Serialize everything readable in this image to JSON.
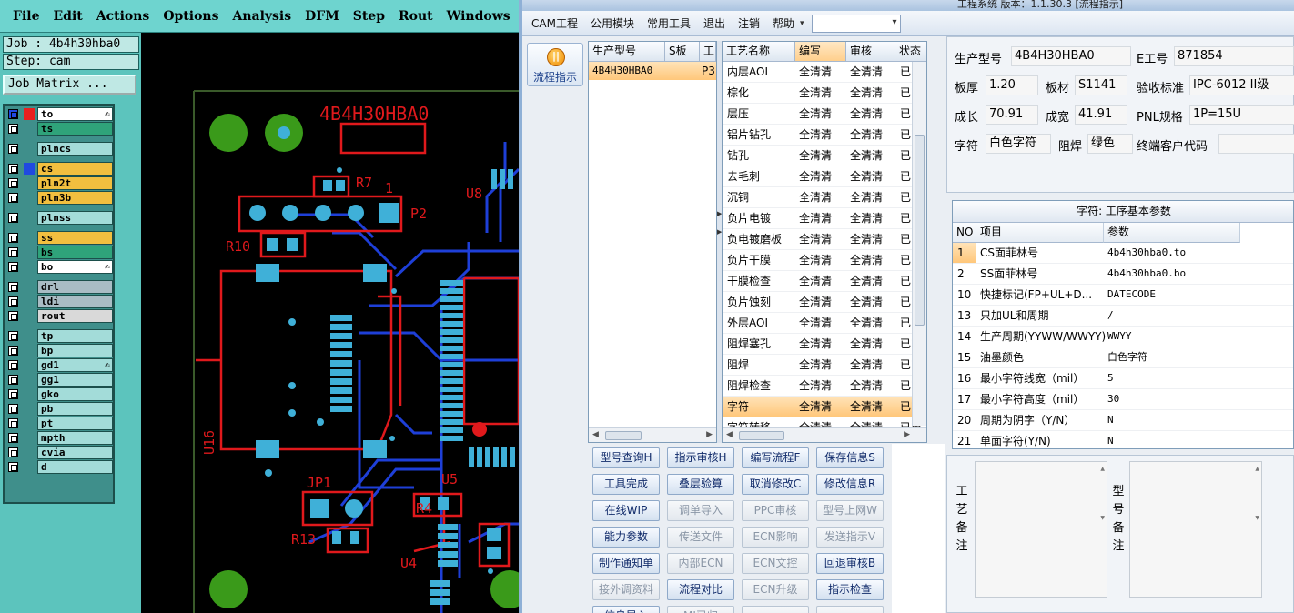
{
  "genesis": {
    "menu": [
      "File",
      "Edit",
      "Actions",
      "Options",
      "Analysis",
      "DFM",
      "Step",
      "Rout",
      "Windows"
    ],
    "job_line": "Job : 4b4h30hba0",
    "step_line": "Step: cam",
    "job_matrix": "Job Matrix ...",
    "layers": [
      {
        "name": "to",
        "color": "#ffffff",
        "swatch": "#e8201f",
        "active": true,
        "edit": true
      },
      {
        "name": "ts",
        "color": "#2fa37a",
        "swatch": "",
        "edit": false
      },
      {
        "name": "plncs",
        "color": "#a3dcd9",
        "swatch": "",
        "edit": false
      },
      {
        "name": "cs",
        "color": "#f2bf3f",
        "swatch": "#2049e0",
        "edit": false
      },
      {
        "name": "pln2t",
        "color": "#f2bf3f",
        "swatch": "",
        "edit": false
      },
      {
        "name": "pln3b",
        "color": "#f2bf3f",
        "swatch": "",
        "edit": false
      },
      {
        "name": "plnss",
        "color": "#a3dcd9",
        "swatch": "",
        "edit": false
      },
      {
        "name": "ss",
        "color": "#f2bf3f",
        "swatch": "",
        "edit": false
      },
      {
        "name": "bs",
        "color": "#2fa37a",
        "swatch": "",
        "edit": false
      },
      {
        "name": "bo",
        "color": "#ffffff",
        "swatch": "",
        "edit": true
      },
      {
        "name": "drl",
        "color": "#a9bcc4",
        "swatch": "",
        "edit": false
      },
      {
        "name": "ldi",
        "color": "#a9bcc4",
        "swatch": "",
        "edit": false
      },
      {
        "name": "rout",
        "color": "#d9d9d9",
        "swatch": "",
        "edit": false
      },
      {
        "name": "tp",
        "color": "#a3dcd9",
        "swatch": "",
        "edit": false
      },
      {
        "name": "bp",
        "color": "#a3dcd9",
        "swatch": "",
        "edit": false
      },
      {
        "name": "gd1",
        "color": "#a3dcd9",
        "swatch": "",
        "edit": true
      },
      {
        "name": "gg1",
        "color": "#a3dcd9",
        "swatch": "",
        "edit": false
      },
      {
        "name": "gko",
        "color": "#a3dcd9",
        "swatch": "",
        "edit": false
      },
      {
        "name": "pb",
        "color": "#a3dcd9",
        "swatch": "",
        "edit": false
      },
      {
        "name": "pt",
        "color": "#a3dcd9",
        "swatch": "",
        "edit": false
      },
      {
        "name": "mpth",
        "color": "#a3dcd9",
        "swatch": "",
        "edit": false
      },
      {
        "name": "cvia",
        "color": "#a3dcd9",
        "swatch": "",
        "edit": false
      },
      {
        "name": "d",
        "color": "#a3dcd9",
        "swatch": "",
        "edit": false
      }
    ],
    "board": {
      "title_text": "4B4H30HBA0",
      "refdes": [
        "R7",
        "1",
        "P2",
        "U8",
        "R10",
        "U16",
        "JP1",
        "U5",
        "R4",
        "R13",
        "U4"
      ]
    }
  },
  "cam": {
    "title_fragment": "工程系统  版本：1.1.30.3  [流程指示]",
    "menu": [
      "CAM工程",
      "公用模块",
      "常用工具",
      "退出",
      "注销",
      "帮助"
    ],
    "flow_button": "流程指示",
    "model_list": {
      "headers": [
        "生产型号",
        "S板",
        "工"
      ],
      "rows": [
        {
          "model": "4B4H30HBA0",
          "s": "P3"
        }
      ]
    },
    "process_list": {
      "headers": [
        "工艺名称",
        "编写",
        "审核",
        "状态"
      ],
      "rows": [
        [
          "内层AOI",
          "全清清",
          "全清清",
          "已审"
        ],
        [
          "棕化",
          "全清清",
          "全清清",
          "已审"
        ],
        [
          "层压",
          "全清清",
          "全清清",
          "已审"
        ],
        [
          "铝片钻孔",
          "全清清",
          "全清清",
          "已审"
        ],
        [
          "钻孔",
          "全清清",
          "全清清",
          "已审"
        ],
        [
          "去毛刺",
          "全清清",
          "全清清",
          "已审"
        ],
        [
          "沉铜",
          "全清清",
          "全清清",
          "已审"
        ],
        [
          "负片电镀",
          "全清清",
          "全清清",
          "已审"
        ],
        [
          "负电镀磨板",
          "全清清",
          "全清清",
          "已审"
        ],
        [
          "负片干膜",
          "全清清",
          "全清清",
          "已审"
        ],
        [
          "干膜检查",
          "全清清",
          "全清清",
          "已审"
        ],
        [
          "负片蚀刻",
          "全清清",
          "全清清",
          "已审"
        ],
        [
          "外层AOI",
          "全清清",
          "全清清",
          "已审"
        ],
        [
          "阻焊塞孔",
          "全清清",
          "全清清",
          "已审"
        ],
        [
          "阻焊",
          "全清清",
          "全清清",
          "已审"
        ],
        [
          "阻焊检查",
          "全清清",
          "全清清",
          "已审"
        ],
        [
          "字符",
          "全清清",
          "全清清",
          "已审"
        ],
        [
          "字符转移",
          "全清清",
          "全清清",
          "已审"
        ]
      ],
      "selected_index": 16
    },
    "buttons": [
      {
        "label": "型号查询H",
        "enabled": true
      },
      {
        "label": "指示审核H",
        "enabled": true
      },
      {
        "label": "编写流程F",
        "enabled": true
      },
      {
        "label": "保存信息S",
        "enabled": true
      },
      {
        "label": "工具完成",
        "enabled": true
      },
      {
        "label": "叠层验算",
        "enabled": true
      },
      {
        "label": "取消修改C",
        "enabled": true
      },
      {
        "label": "修改信息R",
        "enabled": true
      },
      {
        "label": "在线WIP",
        "enabled": true
      },
      {
        "label": "调单导入",
        "enabled": false
      },
      {
        "label": "PPC审核",
        "enabled": false
      },
      {
        "label": "型号上网W",
        "enabled": false
      },
      {
        "label": "能力参数",
        "enabled": true
      },
      {
        "label": "传送文件",
        "enabled": false
      },
      {
        "label": "ECN影响",
        "enabled": false
      },
      {
        "label": "发送指示V",
        "enabled": false
      },
      {
        "label": "制作通知单",
        "enabled": true
      },
      {
        "label": "内部ECN",
        "enabled": false
      },
      {
        "label": "ECN文控",
        "enabled": false
      },
      {
        "label": "回退审核B",
        "enabled": true
      },
      {
        "label": "接外调资料",
        "enabled": false
      },
      {
        "label": "流程对比",
        "enabled": true
      },
      {
        "label": "ECN升级",
        "enabled": false
      },
      {
        "label": "指示检查",
        "enabled": true
      },
      {
        "label": "信息导入",
        "enabled": true
      },
      {
        "label": "MI已归",
        "enabled": false
      },
      {
        "label": "",
        "enabled": false
      },
      {
        "label": "",
        "enabled": false
      }
    ],
    "info": {
      "model_label": "生产型号",
      "model": "4B4H30HBA0",
      "eno_label": "E工号",
      "eno": "871854",
      "thick_label": "板厚",
      "thick": "1.20",
      "mat_label": "板材",
      "mat": "S1141",
      "std_label": "验收标准",
      "std": "IPC-6012 II级",
      "len_label": "成长",
      "len": "70.91",
      "wid_label": "成宽",
      "wid": "41.91",
      "pnl_label": "PNL规格",
      "pnl": "1P=15U",
      "char_label": "字符",
      "char": "白色字符",
      "mask_label": "阻焊",
      "mask": "绿色",
      "cust_label": "终端客户代码",
      "cust": ""
    },
    "params": {
      "title": "字符: 工序基本参数",
      "headers": [
        "NO",
        "项目",
        "参数"
      ],
      "rows": [
        {
          "no": "1",
          "item": "CS面菲林号",
          "val": "4b4h30hba0.to"
        },
        {
          "no": "2",
          "item": "SS面菲林号",
          "val": "4b4h30hba0.bo"
        },
        {
          "no": "10",
          "item": "快捷标记(FP+UL+D...",
          "val": "DATECODE"
        },
        {
          "no": "13",
          "item": "只加UL和周期",
          "val": "/"
        },
        {
          "no": "14",
          "item": "生产周期(YYWW/WWYY)",
          "val": "WWYY"
        },
        {
          "no": "15",
          "item": "油墨颜色",
          "val": "白色字符"
        },
        {
          "no": "16",
          "item": "最小字符线宽（mil）",
          "val": "5"
        },
        {
          "no": "17",
          "item": "最小字符高度（mil）",
          "val": "30"
        },
        {
          "no": "20",
          "item": "周期为阴字（Y/N）",
          "val": "N"
        },
        {
          "no": "21",
          "item": "单面字符(Y/N)",
          "val": "N"
        }
      ]
    },
    "remarks": {
      "proc_label": "工艺备注",
      "model_label": "型号备注"
    }
  }
}
